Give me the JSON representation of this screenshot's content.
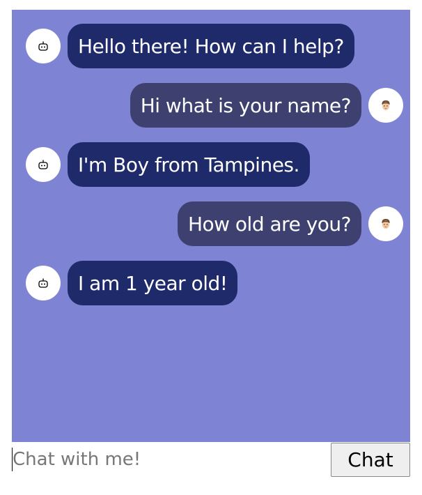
{
  "input": {
    "placeholder": "Chat with me!"
  },
  "chat_button_label": "Chat",
  "messages": [
    {
      "sender": "bot",
      "text": "Hello there! How can I help?",
      "avatar_icon": "robot-icon"
    },
    {
      "sender": "user",
      "text": "Hi what is your name?",
      "avatar_icon": "man-face-icon"
    },
    {
      "sender": "bot",
      "text": "I'm Boy from Tampines.",
      "avatar_icon": "robot-icon"
    },
    {
      "sender": "user",
      "text": "How old are you?",
      "avatar_icon": "man-face-icon"
    },
    {
      "sender": "bot",
      "text": "I am 1 year old!",
      "avatar_icon": "robot-icon"
    }
  ],
  "colors": {
    "chat_background": "#7e84d3",
    "bot_bubble": "#1e2a6a",
    "user_bubble": "#3e4170"
  }
}
